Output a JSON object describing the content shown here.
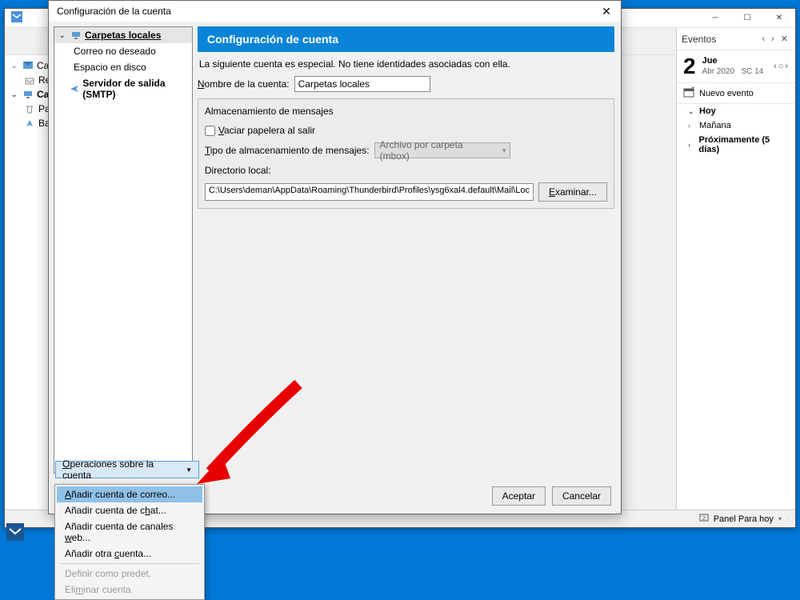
{
  "main_window": {
    "folder_pane": {
      "carpetas_label": "Carp",
      "recibidos": "Recibi",
      "carpetas_locales": "Carp",
      "papelera": "Pap",
      "bandeja": "Ban"
    },
    "toolbar_icons": [
      "calendar",
      "tasks"
    ]
  },
  "events": {
    "title": "Eventos",
    "day_number": "2",
    "day_name": "Jue",
    "month_year": "Abr 2020",
    "week": "SC 14",
    "new_event": "Nuevo evento",
    "agenda": {
      "hoy": "Hoy",
      "manana": "Mañana",
      "proximamente": "Próximamente (5 días)"
    }
  },
  "statusbar": {
    "panel": "Panel Para hoy"
  },
  "dialog": {
    "title": "Configuración de la cuenta",
    "tree": {
      "carpetas_locales": "Carpetas locales",
      "correo_no_deseado": "Correo no deseado",
      "espacio_en_disco": "Espacio en disco",
      "smtp": "Servidor de salida (SMTP)"
    },
    "banner": "Configuración de cuenta",
    "description": "La siguiente cuenta es especial. No tiene identidades asociadas con ella.",
    "name_label": "Nombre de la cuenta:",
    "name_value": "Carpetas locales",
    "storage": {
      "title": "Almacenamiento de mensajes",
      "empty_trash": "Vaciar papelera al salir",
      "type_label": "Tipo de almacenamiento de mensajes:",
      "type_value": "Archivo por carpeta (mbox)",
      "dir_label": "Directorio local:",
      "dir_value": "C:\\Users\\deman\\AppData\\Roaming\\Thunderbird\\Profiles\\ysg6xal4.default\\Mail\\Loc",
      "browse": "Examinar..."
    },
    "ops_button": "Operaciones sobre la cuenta",
    "accept": "Aceptar",
    "cancel": "Cancelar"
  },
  "dropdown": {
    "add_mail": "Añadir cuenta de correo...",
    "add_chat": "Añadir cuenta de chat...",
    "add_web": "Añadir cuenta de canales web...",
    "add_other": "Añadir otra cuenta...",
    "set_default": "Definir como predet.",
    "delete": "Eliminar cuenta"
  }
}
